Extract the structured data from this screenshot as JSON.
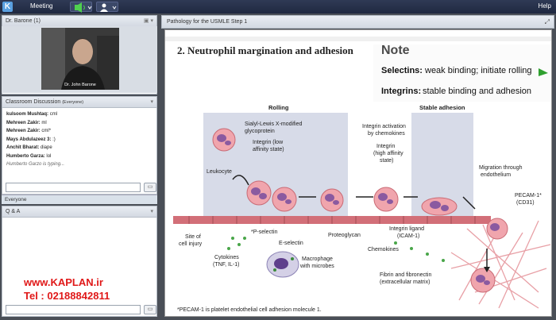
{
  "topbar": {
    "logo": "K",
    "meeting": "Meeting",
    "help": "Help"
  },
  "video": {
    "title": "Dr. Barone",
    "count": "(1)",
    "caption": "Dr. John Barone"
  },
  "discussion": {
    "title": "Classroom Discussion",
    "audience": "(Everyone)",
    "messages": [
      {
        "name": "kulsoom Mushtaq:",
        "text": "cml"
      },
      {
        "name": "Mehreen Zakir:",
        "text": "ml"
      },
      {
        "name": "Mehreen Zakir:",
        "text": "cml*"
      },
      {
        "name": "Mays Abdulazeez 3:",
        "text": ":)"
      },
      {
        "name": "Anchit Bharat:",
        "text": "diape"
      },
      {
        "name": "Humberto Garza:",
        "text": "lol"
      }
    ],
    "typing": "Humberto Garzo is typing...",
    "tab": "Everyone"
  },
  "qa": {
    "title": "Q & A"
  },
  "promo": {
    "site": "www.KAPLAN.ir",
    "phone": "Tel : 02188842811"
  },
  "slide_window": {
    "title": "Pathology for the USMLE Step 1"
  },
  "slide": {
    "heading": "2.  Neutrophil margination and adhesion",
    "note_title": "Note",
    "selectins_label": "Selectins:",
    "selectins_text": "weak binding; initiate rolling",
    "integrins_label": "Integrins:",
    "integrins_text": "stable binding and adhesion",
    "rolling": "Rolling",
    "stable": "Stable adhesion",
    "sialyl": "Sialyl-Lewis X-modified",
    "glyco": "glycoprotein",
    "integrin_low": "Integrin (low",
    "affinity_state": "affinity state)",
    "leukocyte": "Leukocyte",
    "integrin_act": "Integrin activation",
    "by_chemokines": "by chemokines",
    "integrin2": "Integrin",
    "high_aff": "(high affinity",
    "state": "state)",
    "migration": "Migration through",
    "endothelium": "endothelium",
    "pecam": "PECAM-1*",
    "cd31": "(CD31)",
    "pselectin": "*P-selectin",
    "eselectin": "E-selectin",
    "proteoglycan": "Proteoglycan",
    "integrin_ligand": "Integrin ligand",
    "icam": "(ICAM-1)",
    "site": "Site of",
    "cell_injury": "cell injury",
    "cytokines": "Cytokines",
    "tnf": "(TNF, IL-1)",
    "chemokines": "Chemokines",
    "macrophage": "Macrophage",
    "with_microbes": "with microbes",
    "fibrin": "Fibrin and fibronectin",
    "ecm": "(extracellular matrix)",
    "footnote": "*PECAM-1 is platelet endothelial cell adhesion molecule 1."
  }
}
